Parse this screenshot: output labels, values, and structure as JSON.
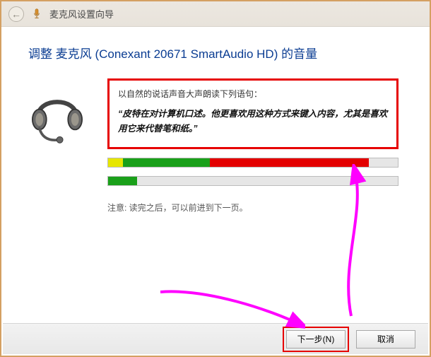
{
  "titlebar": {
    "title": "麦克风设置向导",
    "back_aria": "返回"
  },
  "heading": "调整 麦克风 (Conexant 20671 SmartAudio HD) 的音量",
  "readbox": {
    "instruction": "以自然的说话声音大声朗读下列语句：",
    "quote": "“皮特在对计算机口述。他更喜欢用这种方式来键入内容，尤其是喜欢用它来代替笔和纸。”"
  },
  "meters": {
    "bar1": [
      {
        "color": "m-yellow",
        "pct": 5
      },
      {
        "color": "m-green",
        "pct": 30
      },
      {
        "color": "m-red",
        "pct": 55
      },
      {
        "color": "m-gray",
        "pct": 10
      }
    ],
    "bar2": [
      {
        "color": "m-green",
        "pct": 10
      },
      {
        "color": "m-gray",
        "pct": 90
      }
    ]
  },
  "hint": "注意: 读完之后，可以前进到下一页。",
  "buttons": {
    "next": "下一步(N)",
    "cancel": "取消"
  },
  "colors": {
    "accent_red": "#e60000",
    "arrow": "#ff00ff"
  }
}
